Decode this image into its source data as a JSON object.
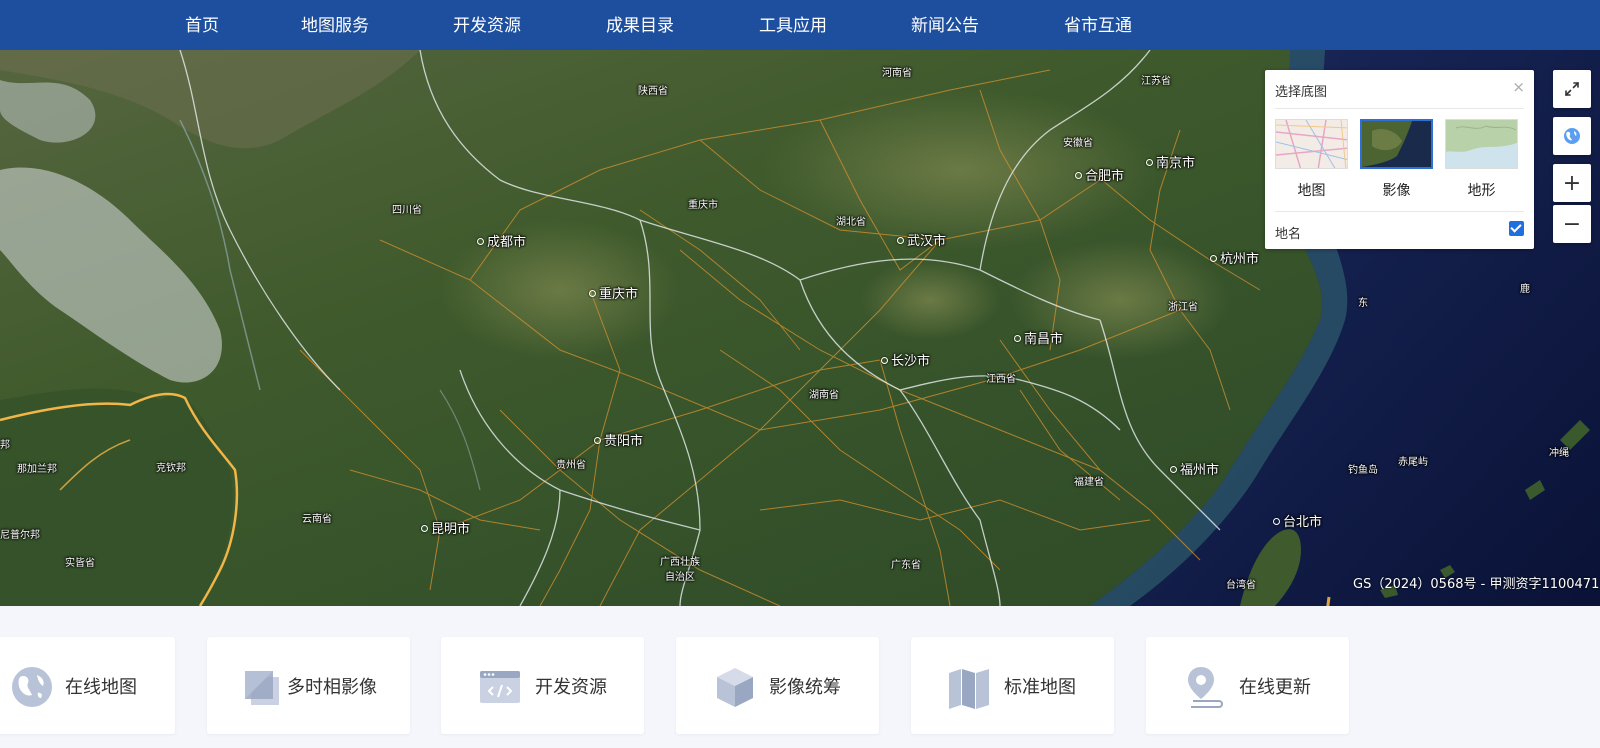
{
  "nav": {
    "items": [
      "首页",
      "地图服务",
      "开发资源",
      "成果目录",
      "工具应用",
      "新闻公告",
      "省市互通"
    ]
  },
  "map": {
    "labels": {
      "henan": "河南省",
      "jiangsu": "江苏省",
      "shaanxi": "陕西省",
      "anhui": "安徽省",
      "hefei": "合肥市",
      "nanjing": "南京市",
      "sichuan": "四川省",
      "chongqing_prov": "重庆市",
      "hubei": "湖北省",
      "chengdu": "成都市",
      "wuhan": "武汉市",
      "hangzhou": "杭州市",
      "chongqing": "重庆市",
      "zhejiang": "浙江省",
      "nanchang": "南昌市",
      "changsha": "长沙市",
      "jiangxi": "江西省",
      "hunan": "湖南省",
      "guiyang": "贵阳市",
      "guizhou": "贵州省",
      "fuzhou": "福州市",
      "fujian": "福建省",
      "yunnan": "云南省",
      "kunming": "昆明市",
      "taipei": "台北市",
      "guangxi_line1": "广西壮族",
      "guangxi_line2": "自治区",
      "guangdong": "广东省",
      "taiwan": "台湾省",
      "diaoyu": "钓鱼岛",
      "chiwei": "赤尾屿",
      "okinawa": "冲绳",
      "nagaland": "那加兰邦",
      "kachin": "克钦邦",
      "manipur": "尼普尔邦",
      "shan": "实皆省",
      "bang": "邦",
      "jeju_1": "东",
      "jeju_2": "鹿"
    },
    "copyright": "GS（2024）0568号 - 甲测资字1100471"
  },
  "basemap_panel": {
    "title": "选择底图",
    "close": "×",
    "options": [
      "地图",
      "影像",
      "地形"
    ],
    "selected": "影像",
    "names_label": "地名",
    "names_checked": true
  },
  "controls": {
    "fullscreen": "fullscreen-icon",
    "globe": "globe-icon",
    "zoom_in": "+",
    "zoom_out": "−"
  },
  "cards": [
    {
      "label": "在线地图",
      "icon": "globe-icon"
    },
    {
      "label": "多时相影像",
      "icon": "layers-icon"
    },
    {
      "label": "开发资源",
      "icon": "code-window-icon"
    },
    {
      "label": "影像统筹",
      "icon": "cube-icon"
    },
    {
      "label": "标准地图",
      "icon": "folded-map-icon"
    },
    {
      "label": "在线更新",
      "icon": "location-pin-icon"
    }
  ],
  "colors": {
    "nav_bg": "#1d4f9e",
    "accent": "#2d6fd6",
    "page_bg": "#f4f6fb",
    "card_icon": "#b9c3d8"
  }
}
